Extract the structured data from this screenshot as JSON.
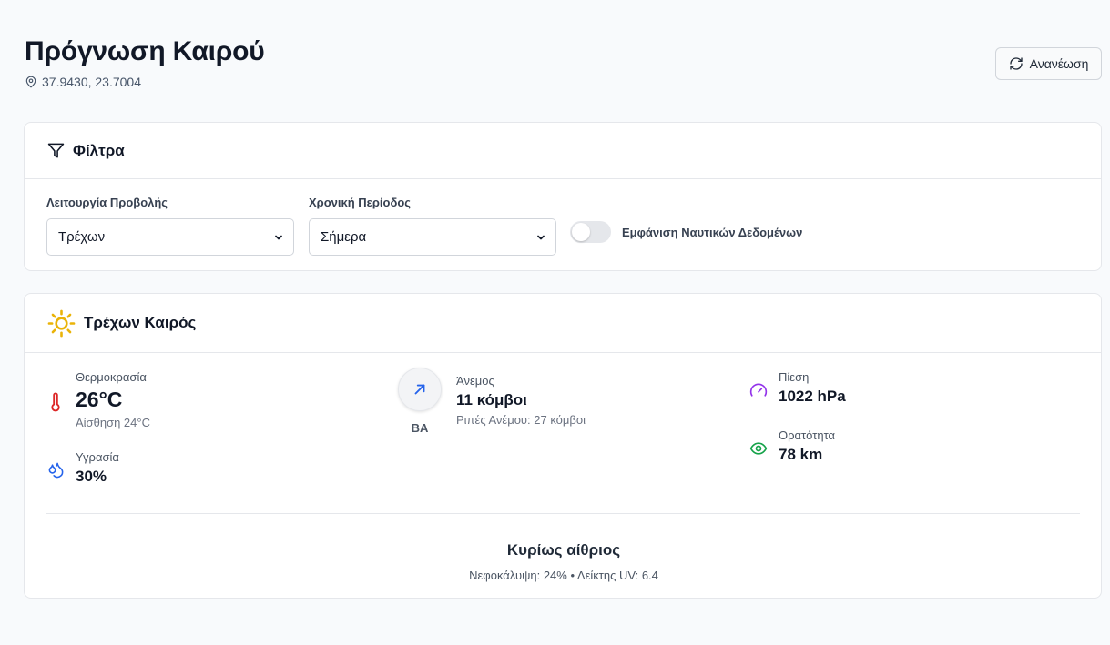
{
  "header": {
    "title": "Πρόγνωση Καιρού",
    "coordinates": "37.9430, 23.7004",
    "refresh_label": "Ανανέωση"
  },
  "filters": {
    "title": "Φίλτρα",
    "view_mode": {
      "label": "Λειτουργία Προβολής",
      "selected": "Τρέχων"
    },
    "period": {
      "label": "Χρονική Περίοδος",
      "selected": "Σήμερα"
    },
    "nautical_toggle": {
      "label": "Εμφάνιση Ναυτικών Δεδομένων",
      "on": false
    }
  },
  "current": {
    "title": "Τρέχων Καιρός",
    "temperature": {
      "label": "Θερμοκρασία",
      "value": "26°C",
      "feels_like": "Αίσθηση 24°C"
    },
    "humidity": {
      "label": "Υγρασία",
      "value": "30%"
    },
    "wind": {
      "label": "Άνεμος",
      "value": "11 κόμβοι",
      "gusts": "Ριπές Ανέμου: 27 κόμβοι",
      "direction": "ΒΑ"
    },
    "pressure": {
      "label": "Πίεση",
      "value": "1022 hPa"
    },
    "visibility": {
      "label": "Ορατότητα",
      "value": "78 km"
    },
    "summary": "Κυρίως αίθριος",
    "details": "Νεφοκάλυψη: 24% • Δείκτης UV: 6.4"
  },
  "colors": {
    "accent_blue": "#2563eb",
    "sun": "#eab308",
    "thermometer": "#dc2626",
    "pressure": "#9333ea",
    "visibility": "#16a34a"
  },
  "icons": [
    "map-pin-icon",
    "refresh-icon",
    "filter-icon",
    "chevron-down-icon",
    "sun-icon",
    "thermometer-icon",
    "droplets-icon",
    "wind-arrow-icon",
    "gauge-icon",
    "eye-icon"
  ]
}
